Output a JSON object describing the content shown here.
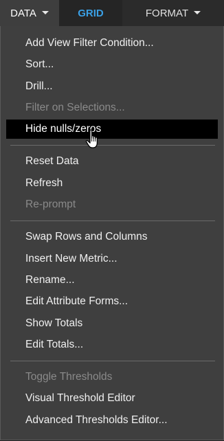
{
  "tabs": {
    "data": "DATA",
    "grid": "GRID",
    "format": "FORMAT"
  },
  "menu": {
    "groups": [
      [
        "Add View Filter Condition...",
        "Sort...",
        "Drill...",
        "Filter on Selections...",
        "Hide nulls/zeros"
      ],
      [
        "Reset Data",
        "Refresh",
        "Re-prompt"
      ],
      [
        "Swap Rows and Columns",
        "Insert New Metric...",
        "Rename...",
        "Edit Attribute Forms...",
        "Show Totals",
        "Edit Totals..."
      ],
      [
        "Toggle Thresholds",
        "Visual Threshold Editor",
        "Advanced Thresholds Editor..."
      ]
    ],
    "disabled_items": [
      "Filter on Selections...",
      "Re-prompt",
      "Toggle Thresholds"
    ],
    "highlighted_item": "Hide nulls/zeros"
  },
  "colors": {
    "menu_bg": "#3f3f3f",
    "highlight_bg": "#000000",
    "grid_tab": "#3aa0e6",
    "disabled_text": "#8a8a8a"
  },
  "icons": {
    "cursor": "hand-pointer-icon",
    "dropdown": "caret-down-icon"
  }
}
